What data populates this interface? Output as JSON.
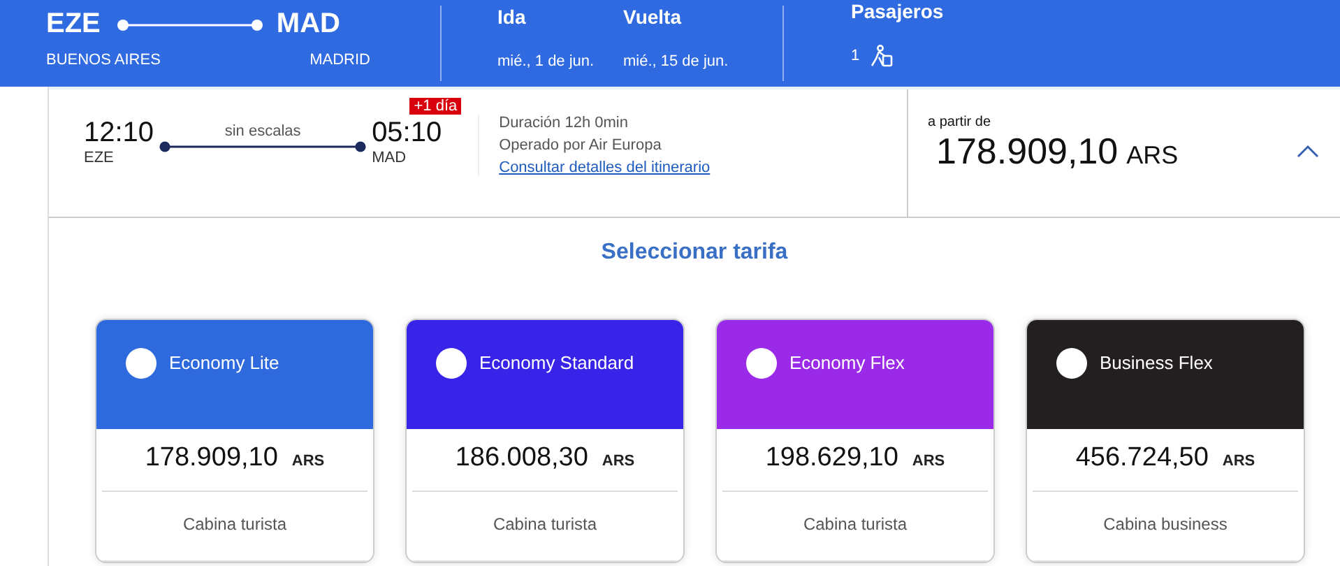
{
  "header": {
    "origin": {
      "code": "EZE",
      "city": "BUENOS AIRES"
    },
    "destination": {
      "code": "MAD",
      "city": "MADRID"
    },
    "dates": [
      {
        "label": "Ida",
        "value": "mié., 1 de jun."
      },
      {
        "label": "Vuelta",
        "value": "mié., 15 de jun."
      }
    ],
    "passengers": {
      "label": "Pasajeros",
      "count": "1"
    }
  },
  "flight": {
    "departure": {
      "time": "12:10",
      "airport": "EZE"
    },
    "stops": "sin escalas",
    "arrival": {
      "time": "05:10",
      "airport": "MAD",
      "badge": "+1 día"
    },
    "duration": "Duración 12h 0min",
    "operator": "Operado por Air Europa",
    "details_link": "Consultar detalles del itinerario",
    "price_label": "a partir de",
    "price": "178.909,10",
    "currency": "ARS",
    "expanded": true
  },
  "fare_title": "Seleccionar tarifa",
  "fares": [
    {
      "name": "Economy Lite",
      "color": "#2e6ade",
      "selected": false,
      "price": "178.909,10",
      "currency": "ARS",
      "cabin": "Cabina turista"
    },
    {
      "name": "Economy Standard",
      "color": "#3823e8",
      "selected": false,
      "price": "186.008,30",
      "currency": "ARS",
      "cabin": "Cabina turista"
    },
    {
      "name": "Economy Flex",
      "color": "#9b2ae8",
      "selected": false,
      "price": "198.629,10",
      "currency": "ARS",
      "cabin": "Cabina turista"
    },
    {
      "name": "Business Flex",
      "color": "#231f20",
      "selected": false,
      "price": "456.724,50",
      "currency": "ARS",
      "cabin": "Cabina business"
    }
  ]
}
